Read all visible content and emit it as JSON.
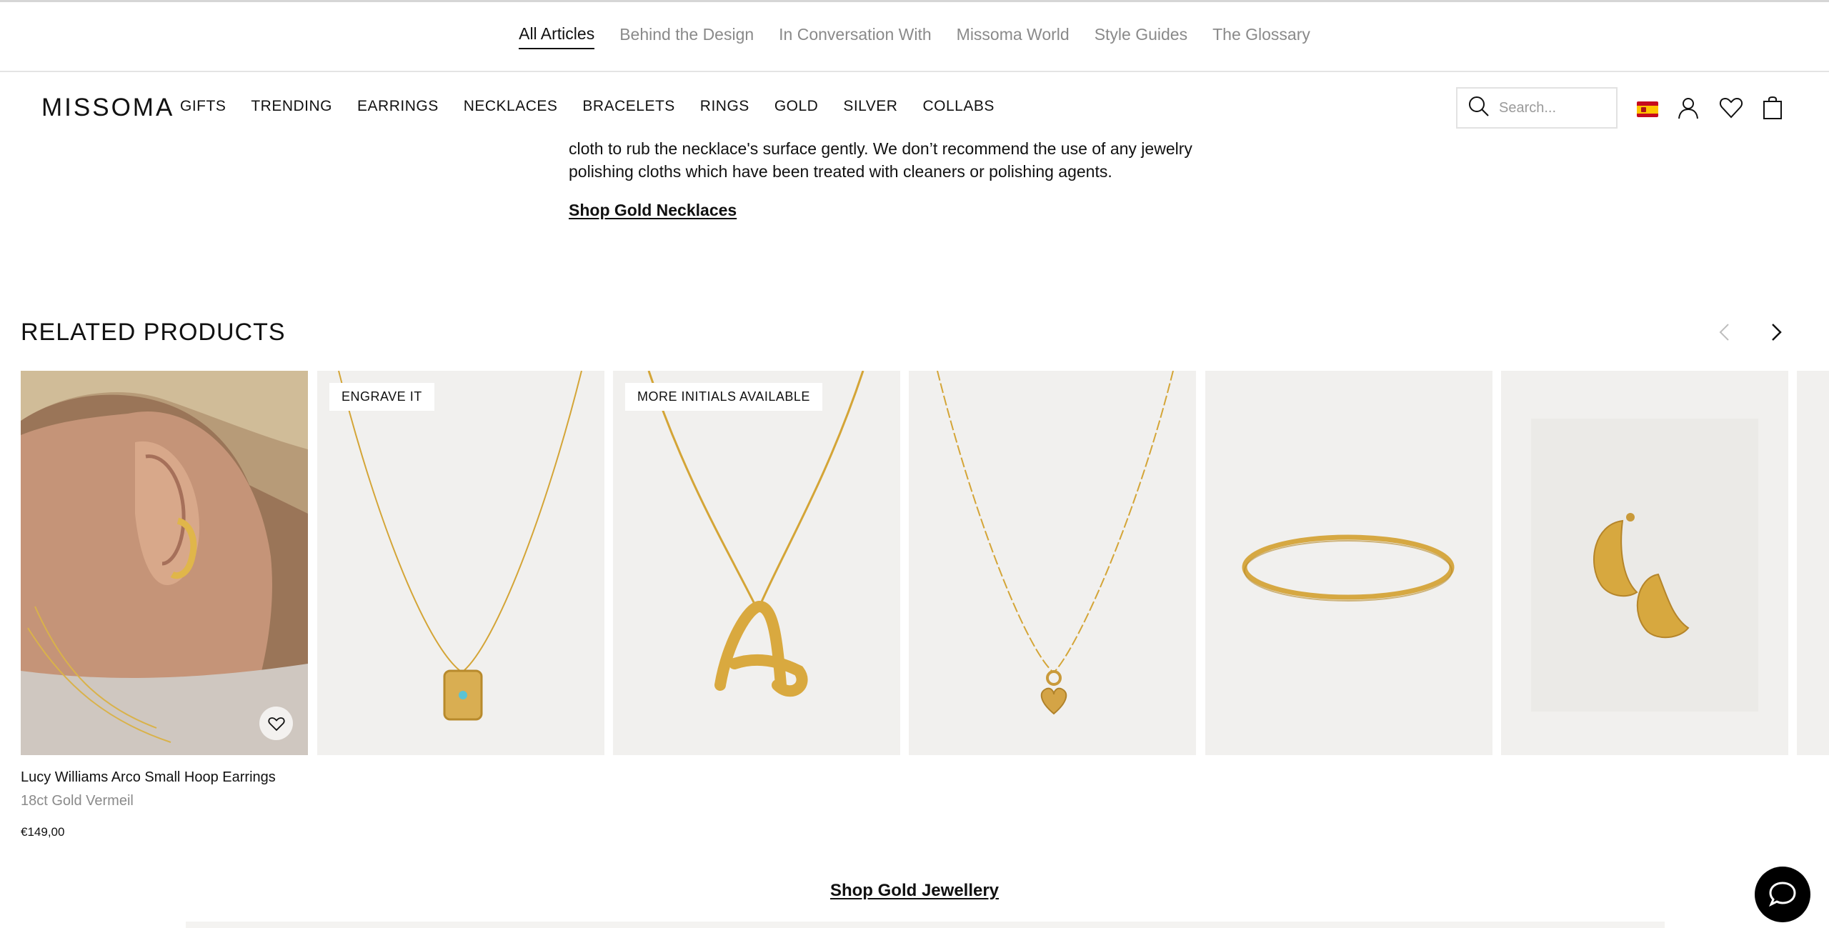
{
  "article_nav": {
    "items": [
      "All Articles",
      "Behind the Design",
      "In Conversation With",
      "Missoma World",
      "Style Guides",
      "The Glossary"
    ]
  },
  "header": {
    "logo": "MISSOMA",
    "nav": [
      "GIFTS",
      "TRENDING",
      "EARRINGS",
      "NECKLACES",
      "BRACELETS",
      "RINGS",
      "GOLD",
      "SILVER",
      "COLLABS"
    ],
    "search_placeholder": "Search...",
    "flag": "spain-flag-icon",
    "icons": [
      "search-icon",
      "account-icon",
      "wishlist-heart-icon",
      "shopping-bag-icon"
    ]
  },
  "article": {
    "text": "cloth to rub the necklace's surface gently. We don’t recommend the use of any jewelry polishing cloths which have been treated with cleaners or polishing agents.",
    "link": "Shop Gold Necklaces"
  },
  "related": {
    "title": "RELATED PRODUCTS",
    "products": [
      {
        "name": "Lucy Williams Arco Small Hoop Earrings",
        "material": "18ct Gold Vermeil",
        "price": "€149,00",
        "badge": ""
      },
      {
        "name": "",
        "material": "",
        "price": "",
        "badge": "ENGRAVE IT"
      },
      {
        "name": "",
        "material": "",
        "price": "",
        "badge": "MORE INITIALS AVAILABLE"
      },
      {
        "name": "",
        "material": "",
        "price": "",
        "badge": ""
      },
      {
        "name": "",
        "material": "",
        "price": "",
        "badge": ""
      },
      {
        "name": "",
        "material": "",
        "price": "",
        "badge": ""
      }
    ]
  },
  "bottom_link": "Shop Gold Jewellery",
  "colors": {
    "text": "#111111",
    "muted": "#8a8a8a",
    "border": "#e2e2e2",
    "gold": "#d4a537",
    "chat": "#000000"
  }
}
